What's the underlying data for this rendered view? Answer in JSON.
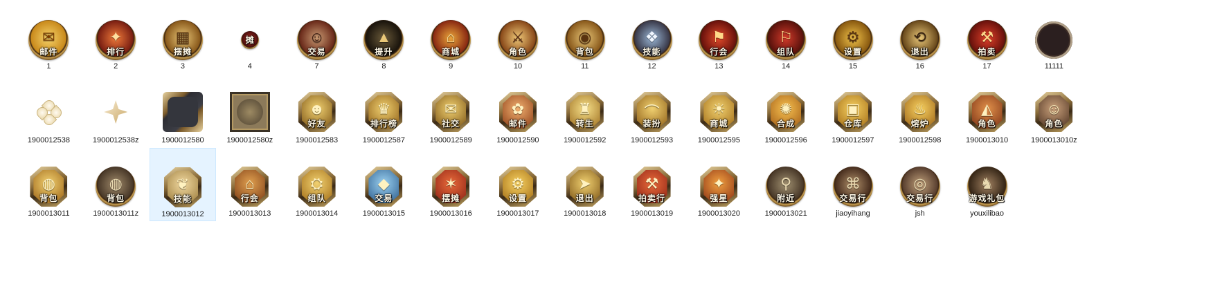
{
  "rows": [
    {
      "items": [
        {
          "label": "1",
          "caption": "邮件",
          "kind": "round",
          "c1": "#f6d36a",
          "c2": "#c98a1c",
          "glyph": "✉",
          "g": "#7a3b00"
        },
        {
          "label": "2",
          "caption": "排行",
          "kind": "round",
          "c1": "#f07a3a",
          "c2": "#7a1f12",
          "glyph": "✦",
          "g": "#ffe0a0"
        },
        {
          "label": "3",
          "caption": "摆摊",
          "kind": "round",
          "c1": "#e9c778",
          "c2": "#8a5a1c",
          "glyph": "▦",
          "g": "#5a3410"
        },
        {
          "label": "4",
          "caption": "摊",
          "kind": "small",
          "c1": "#c23a2a",
          "c2": "#4a0d0d",
          "glyph": "",
          "g": "#fff"
        },
        {
          "label": "7",
          "caption": "交易",
          "kind": "round",
          "c1": "#c99a72",
          "c2": "#6a2a1a",
          "glyph": "☺",
          "g": "#3a1a10"
        },
        {
          "label": "8",
          "caption": "提升",
          "kind": "round",
          "c1": "#6a5a3a",
          "c2": "#1a140c",
          "glyph": "▲",
          "g": "#e9c778"
        },
        {
          "label": "9",
          "caption": "商城",
          "kind": "round",
          "c1": "#e9a43a",
          "c2": "#8a2a12",
          "glyph": "⌂",
          "g": "#ffe6a0"
        },
        {
          "label": "10",
          "caption": "角色",
          "kind": "round",
          "c1": "#f0c978",
          "c2": "#8a4a1a",
          "glyph": "⚔",
          "g": "#5a2a10"
        },
        {
          "label": "11",
          "caption": "背包",
          "kind": "round",
          "c1": "#e9c778",
          "c2": "#8a5a1c",
          "glyph": "◉",
          "g": "#5a3410"
        },
        {
          "label": "12",
          "caption": "技能",
          "kind": "round",
          "c1": "#9ab7d6",
          "c2": "#3a3a4a",
          "glyph": "❖",
          "g": "#f0f6ff"
        },
        {
          "label": "13",
          "caption": "行会",
          "kind": "round",
          "c1": "#e04a2a",
          "c2": "#6a120c",
          "glyph": "⚑",
          "g": "#ffd98a"
        },
        {
          "label": "14",
          "caption": "组队",
          "kind": "round",
          "c1": "#d23a2a",
          "c2": "#5a120c",
          "glyph": "⚐",
          "g": "#ffd98a"
        },
        {
          "label": "15",
          "caption": "设置",
          "kind": "round",
          "c1": "#f0c24a",
          "c2": "#8a5a10",
          "glyph": "⚙",
          "g": "#5a3410"
        },
        {
          "label": "16",
          "caption": "退出",
          "kind": "round",
          "c1": "#e9c778",
          "c2": "#6a4a1c",
          "glyph": "⟲",
          "g": "#3a2410"
        },
        {
          "label": "17",
          "caption": "拍卖",
          "kind": "round",
          "c1": "#e0402a",
          "c2": "#6a120c",
          "glyph": "⚒",
          "g": "#ffd98a"
        },
        {
          "label": "11111",
          "caption": "",
          "kind": "ring",
          "c1": "",
          "c2": "",
          "glyph": "",
          "g": ""
        }
      ]
    },
    {
      "items": [
        {
          "label": "1900012538",
          "caption": "",
          "kind": "flower"
        },
        {
          "label": "1900012538z",
          "caption": "",
          "kind": "star4"
        },
        {
          "label": "1900012580",
          "caption": "",
          "kind": "frame"
        },
        {
          "label": "1900012580z",
          "caption": "",
          "kind": "frame2"
        },
        {
          "label": "1900012583",
          "caption": "好友",
          "kind": "oct",
          "c1": "#f0d070",
          "c2": "#7a5214",
          "glyph": "☻",
          "g": "#fff2c0"
        },
        {
          "label": "1900012587",
          "caption": "排行榜",
          "kind": "oct",
          "c1": "#f0d070",
          "c2": "#8a5a14",
          "glyph": "♛",
          "g": "#fff2c0"
        },
        {
          "label": "1900012589",
          "caption": "社交",
          "kind": "oct",
          "c1": "#f0d070",
          "c2": "#7a5214",
          "glyph": "✉",
          "g": "#fff2c0"
        },
        {
          "label": "1900012590",
          "caption": "邮件",
          "kind": "oct",
          "c1": "#f0b070",
          "c2": "#8a3a14",
          "glyph": "✿",
          "g": "#fff2c0"
        },
        {
          "label": "1900012592",
          "caption": "转生",
          "kind": "oct",
          "c1": "#f6e08a",
          "c2": "#9a6a1c",
          "glyph": "♜",
          "g": "#fff2c0"
        },
        {
          "label": "1900012593",
          "caption": "装扮",
          "kind": "oct",
          "c1": "#f0d070",
          "c2": "#8a5a14",
          "glyph": "⌒",
          "g": "#fff2c0"
        },
        {
          "label": "1900012595",
          "caption": "商城",
          "kind": "oct",
          "c1": "#f0d070",
          "c2": "#a06a14",
          "glyph": "☀",
          "g": "#fff2c0"
        },
        {
          "label": "1900012596",
          "caption": "合成",
          "kind": "oct",
          "c1": "#f6c050",
          "c2": "#a05a14",
          "glyph": "✺",
          "g": "#fff2c0"
        },
        {
          "label": "1900012597",
          "caption": "仓库",
          "kind": "oct",
          "c1": "#f6d060",
          "c2": "#a06a14",
          "glyph": "▣",
          "g": "#fff2c0"
        },
        {
          "label": "1900012598",
          "caption": "熔炉",
          "kind": "oct",
          "c1": "#f6d060",
          "c2": "#9a6014",
          "glyph": "♨",
          "g": "#fff2c0"
        },
        {
          "label": "1900013010",
          "caption": "角色",
          "kind": "oct",
          "c1": "#e0904a",
          "c2": "#7a3014",
          "glyph": "◭",
          "g": "#fff2c0"
        },
        {
          "label": "1900013010z",
          "caption": "角色",
          "kind": "oct",
          "c1": "#c9a07a",
          "c2": "#4a3020",
          "glyph": "☺",
          "g": "#fff2c0"
        }
      ]
    },
    {
      "items": [
        {
          "label": "1900013011",
          "caption": "背包",
          "kind": "oct",
          "c1": "#f0d070",
          "c2": "#9a6014",
          "glyph": "◍",
          "g": "#fff2c0"
        },
        {
          "label": "1900013011z",
          "caption": "背包",
          "kind": "round",
          "c1": "#a08a6a",
          "c2": "#4a3a2a",
          "glyph": "◍",
          "g": "#e9d9b0"
        },
        {
          "label": "1900013012",
          "caption": "技能",
          "kind": "oct",
          "c1": "#f0d8a0",
          "c2": "#9a7a3a",
          "glyph": "❦",
          "g": "#fff2c0",
          "selected": true
        },
        {
          "label": "1900013013",
          "caption": "行会",
          "kind": "oct",
          "c1": "#e0a050",
          "c2": "#7a3a14",
          "glyph": "⌂",
          "g": "#fff2c0"
        },
        {
          "label": "1900013014",
          "caption": "组队",
          "kind": "oct",
          "c1": "#f0d070",
          "c2": "#a06a14",
          "glyph": "⛭",
          "g": "#fff2c0"
        },
        {
          "label": "1900013015",
          "caption": "交易",
          "kind": "oct",
          "c1": "#9ad0f0",
          "c2": "#2a5a8a",
          "glyph": "◆",
          "g": "#fff2c0"
        },
        {
          "label": "1900013016",
          "caption": "摆摊",
          "kind": "oct",
          "c1": "#e86a3a",
          "c2": "#8a2014",
          "glyph": "✶",
          "g": "#fff2c0"
        },
        {
          "label": "1900013017",
          "caption": "设置",
          "kind": "oct",
          "c1": "#f6d060",
          "c2": "#a06a14",
          "glyph": "⚙",
          "g": "#fff2c0"
        },
        {
          "label": "1900013018",
          "caption": "退出",
          "kind": "oct",
          "c1": "#f0d070",
          "c2": "#7a5214",
          "glyph": "➤",
          "g": "#fff2c0"
        },
        {
          "label": "1900013019",
          "caption": "拍卖行",
          "kind": "oct",
          "c1": "#e86a3a",
          "c2": "#8a2014",
          "glyph": "⚒",
          "g": "#fff2c0"
        },
        {
          "label": "1900013020",
          "caption": "强星",
          "kind": "oct",
          "c1": "#f0a040",
          "c2": "#8a3014",
          "glyph": "✦",
          "g": "#fff2c0"
        },
        {
          "label": "1900013021",
          "caption": "附近",
          "kind": "round",
          "c1": "#a09070",
          "c2": "#4a3a2a",
          "glyph": "⚲",
          "g": "#e9d9b0"
        },
        {
          "label": "jiaoyihang",
          "caption": "交易行",
          "kind": "round",
          "c1": "#b0906a",
          "c2": "#4a3020",
          "glyph": "⌘",
          "g": "#e9d9b0"
        },
        {
          "label": "jsh",
          "caption": "交易行",
          "kind": "round",
          "c1": "#c0a07a",
          "c2": "#5a4030",
          "glyph": "◎",
          "g": "#e9d9b0"
        },
        {
          "label": "youxilibao",
          "caption": "游戏礼包",
          "kind": "round",
          "c1": "#a08060",
          "c2": "#3a2a1a",
          "glyph": "♞",
          "g": "#e9d9b0"
        }
      ]
    }
  ]
}
